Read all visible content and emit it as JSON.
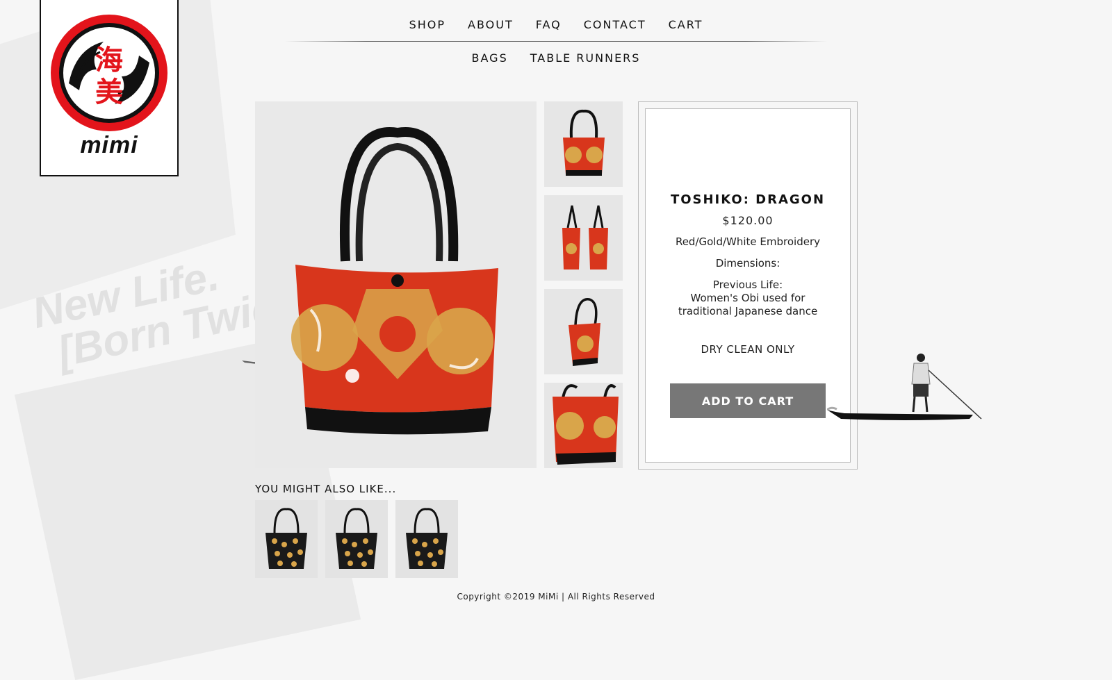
{
  "background": {
    "tagline_line1": "New Life.",
    "tagline_line2": "[Born Twice]"
  },
  "logo": {
    "kanji_top": "海",
    "kanji_bottom": "美",
    "wordmark": "mimi",
    "colors": {
      "red": "#e3141b",
      "black": "#111111"
    }
  },
  "nav": {
    "primary": [
      "SHOP",
      "ABOUT",
      "FAQ",
      "CONTACT",
      "CART"
    ],
    "secondary": [
      "BAGS",
      "TABLE RUNNERS"
    ]
  },
  "product": {
    "title": "TOSHIKO: DRAGON",
    "price": "$120.00",
    "material": "Red/Gold/White Embroidery",
    "dimensions": "Dimensions:",
    "previous_life_label": "Previous Life:",
    "previous_life_line1": "Women's Obi used for",
    "previous_life_line2": "traditional Japanese dance",
    "care": "DRY CLEAN ONLY",
    "add_to_cart": "ADD TO CART",
    "colors": {
      "bag_red": "#d8361c",
      "bag_gold": "#d9a54a",
      "button": "#777777"
    }
  },
  "also_like": {
    "title": "YOU MIGHT ALSO LIKE..."
  },
  "footer": {
    "copyright": "Copyright ©2019 MiMi | All Rights Reserved"
  }
}
